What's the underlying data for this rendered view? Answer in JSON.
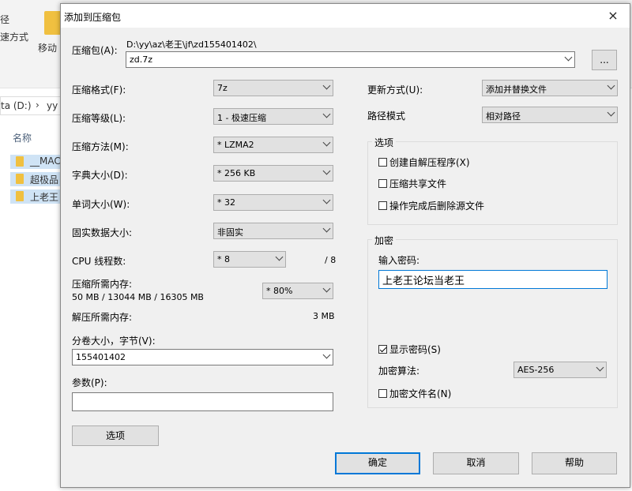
{
  "explorer": {
    "ribbon_text_1": "径",
    "ribbon_text_2": "速方式",
    "move_label": "移动",
    "path_drive": "ta (D:)",
    "path_sep": "›",
    "path_folder": "yy",
    "column_name": "名称",
    "files": [
      "__MAC",
      "超极品",
      "上老王"
    ]
  },
  "dialog": {
    "title": "添加到压缩包",
    "archive_label": "压缩包(A):",
    "archive_path": "D:\\yy\\az\\老王\\jf\\zd155401402\\",
    "archive_name": "zd.7z",
    "browse_label": "...",
    "format_label": "压缩格式(F):",
    "format_value": "7z",
    "level_label": "压缩等级(L):",
    "level_value": "1 - 极速压缩",
    "method_label": "压缩方法(M):",
    "method_value": "* LZMA2",
    "dict_label": "字典大小(D):",
    "dict_value": "* 256 KB",
    "word_label": "单词大小(W):",
    "word_value": "* 32",
    "solid_label": "固实数据大小:",
    "solid_value": "非固实",
    "cpu_label": "CPU 线程数:",
    "cpu_value": "* 8",
    "cpu_max": "/ 8",
    "mem_comp_label": "压缩所需内存:",
    "mem_comp_value": "50 MB / 13044 MB / 16305 MB",
    "mem_percent": "* 80%",
    "mem_decomp_label": "解压所需内存:",
    "mem_decomp_value": "3 MB",
    "split_label": "分卷大小，字节(V):",
    "split_value": "155401402",
    "params_label": "参数(P):",
    "params_value": "",
    "options_button": "选项",
    "update_label": "更新方式(U):",
    "update_value": "添加并替换文件",
    "pathmode_label": "路径模式",
    "pathmode_value": "相对路径",
    "options_group": "选项",
    "opt_sfx": "创建自解压程序(X)",
    "opt_shared": "压缩共享文件",
    "opt_delete": "操作完成后删除源文件",
    "encrypt_group": "加密",
    "password_label": "输入密码:",
    "password_value": "上老王论坛当老王",
    "show_password": "显示密码(S)",
    "enc_method_label": "加密算法:",
    "enc_method_value": "AES-256",
    "enc_names": "加密文件名(N)",
    "ok": "确定",
    "cancel": "取消",
    "help": "帮助",
    "close_icon": "×"
  }
}
